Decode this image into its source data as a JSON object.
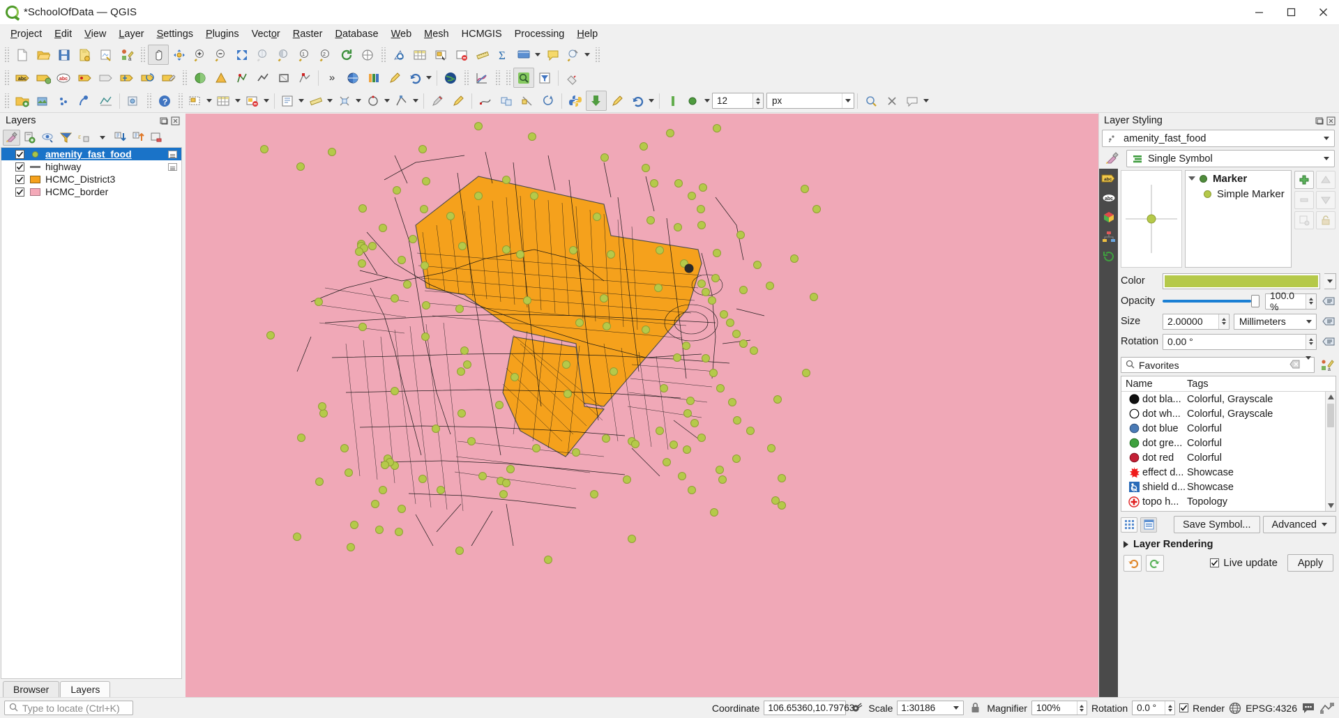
{
  "window": {
    "title": "*SchoolOfData — QGIS",
    "app_icon": "qgis-logo-icon",
    "minimize": "minimize-icon",
    "maximize": "maximize-icon",
    "close": "close-icon"
  },
  "menubar": {
    "items": [
      {
        "label": "Project",
        "mnemonic": "P"
      },
      {
        "label": "Edit",
        "mnemonic": "E"
      },
      {
        "label": "View",
        "mnemonic": "V"
      },
      {
        "label": "Layer",
        "mnemonic": "L"
      },
      {
        "label": "Settings",
        "mnemonic": "S"
      },
      {
        "label": "Plugins",
        "mnemonic": "P"
      },
      {
        "label": "Vector",
        "mnemonic": "o"
      },
      {
        "label": "Raster",
        "mnemonic": "R"
      },
      {
        "label": "Database",
        "mnemonic": "D"
      },
      {
        "label": "Web",
        "mnemonic": "W"
      },
      {
        "label": "Mesh",
        "mnemonic": "M"
      },
      {
        "label": "HCMGIS",
        "mnemonic": ""
      },
      {
        "label": "Processing",
        "mnemonic": ""
      },
      {
        "label": "Help",
        "mnemonic": "H"
      }
    ]
  },
  "toolbar": {
    "overflow_label": "»",
    "size_value": "12",
    "size_unit": "px"
  },
  "layers_panel": {
    "title": "Layers",
    "toolbar_icons": [
      "open-layer-styling-panel-icon",
      "add-group-icon",
      "manage-map-themes-icon",
      "filter-legend-icon",
      "filter-legend-expression-icon",
      "expand-all-icon",
      "collapse-all-icon",
      "remove-layer-icon"
    ],
    "items": [
      {
        "name": "amenity_fast_food",
        "symbol": "point-green",
        "checked": true,
        "selected": true,
        "has_badge": true
      },
      {
        "name": "highway",
        "symbol": "line-gray",
        "checked": true,
        "selected": false,
        "has_badge": true
      },
      {
        "name": "HCMC_District3",
        "symbol": "fill-orange",
        "checked": true,
        "selected": false,
        "has_badge": false
      },
      {
        "name": "HCMC_border",
        "symbol": "fill-pink",
        "checked": true,
        "selected": false,
        "has_badge": false
      }
    ],
    "tabs": [
      {
        "label": "Browser",
        "active": false
      },
      {
        "label": "Layers",
        "active": true
      }
    ]
  },
  "style_panel": {
    "title": "Layer Styling",
    "dock_icon": "undock-icon",
    "close_icon": "close-icon",
    "layer_selector": "amenity_fast_food",
    "renderer": "Single Symbol",
    "renderer_icon": "single-symbol-icon",
    "style_brush_icon": "symbology-icon",
    "vtabs": [
      "labels-icon",
      "masks-icon",
      "3d-view-icon",
      "diagrams-icon",
      "history-icon"
    ],
    "symbol_tree": [
      {
        "label": "Marker",
        "level": 0,
        "dot": "dark"
      },
      {
        "label": "Simple Marker",
        "level": 1,
        "dot": "olive"
      }
    ],
    "side_buttons": [
      "add-symbol-layer-button",
      "move-up-button",
      "remove-symbol-layer-button",
      "move-down-button",
      "duplicate-button",
      "lock-button"
    ],
    "properties": {
      "color_label": "Color",
      "color_value": "#b5c94a",
      "opacity_label": "Opacity",
      "opacity_value": "100.0 %",
      "opacity_percent": 100,
      "size_label": "Size",
      "size_value": "2.00000",
      "size_unit": "Millimeters",
      "rotation_label": "Rotation",
      "rotation_value": "0.00 °"
    },
    "search": {
      "value": "Favorites",
      "icon": "search-icon",
      "clear_icon": "clear-icon",
      "dropdown_icon": "chevron-down-icon",
      "style_manager_icon": "style-manager-icon"
    },
    "symbol_table": {
      "columns": [
        "Name",
        "Tags"
      ],
      "rows": [
        {
          "name": "dot  bla...",
          "tags": "Colorful, Grayscale",
          "swatch": "#111111",
          "stroke": "#000000"
        },
        {
          "name": "dot  wh...",
          "tags": "Colorful, Grayscale",
          "swatch": "#ffffff",
          "stroke": "#000000"
        },
        {
          "name": "dot blue",
          "tags": "Colorful",
          "swatch": "#4a7ab5",
          "stroke": "#2e4f78"
        },
        {
          "name": "dot gre...",
          "tags": "Colorful",
          "swatch": "#3fa13f",
          "stroke": "#1f6b1f"
        },
        {
          "name": "dot red",
          "tags": "Colorful",
          "swatch": "#c31f35",
          "stroke": "#7d1020"
        },
        {
          "name": "effect d...",
          "tags": "Showcase",
          "swatch": "#ef1b1b",
          "stroke": "#b01010"
        },
        {
          "name": "shield d...",
          "tags": "Showcase",
          "swatch": "#2a6bb8",
          "stroke": "#1b4a82"
        },
        {
          "name": "topo h...",
          "tags": "Topology",
          "swatch": "#e02020",
          "stroke": "#a81414"
        }
      ]
    },
    "view_buttons": [
      "icon-view-button",
      "list-view-button"
    ],
    "save_symbol_label": "Save Symbol...",
    "advanced_label": "Advanced",
    "layer_rendering_label": "Layer Rendering",
    "undo_icon": "undo-icon",
    "redo_icon": "redo-icon",
    "live_update_label": "Live update",
    "live_update_checked": true,
    "apply_label": "Apply"
  },
  "statusbar": {
    "locate_placeholder": "Type to locate (Ctrl+K)",
    "coordinate_label": "Coordinate",
    "coordinate_value": "106.65360,10.79763",
    "toggle_extents_icon": "toggle-extents-icon",
    "scale_label": "Scale",
    "scale_value": "1:30186",
    "lock_icon": "lock-scale-icon",
    "magnifier_label": "Magnifier",
    "magnifier_value": "100%",
    "rotation_label": "Rotation",
    "rotation_value": "0.0 °",
    "render_label": "Render",
    "render_checked": true,
    "crs_icon": "globe-icon",
    "crs_value": "EPSG:4326",
    "messages_icon": "messages-icon",
    "log_icon": "log-icon"
  },
  "map": {
    "background_color": "#f0a8b7",
    "district_color": "#f5a11c",
    "point_color": "#b5c94a",
    "road_color": "#1a1a1a"
  }
}
